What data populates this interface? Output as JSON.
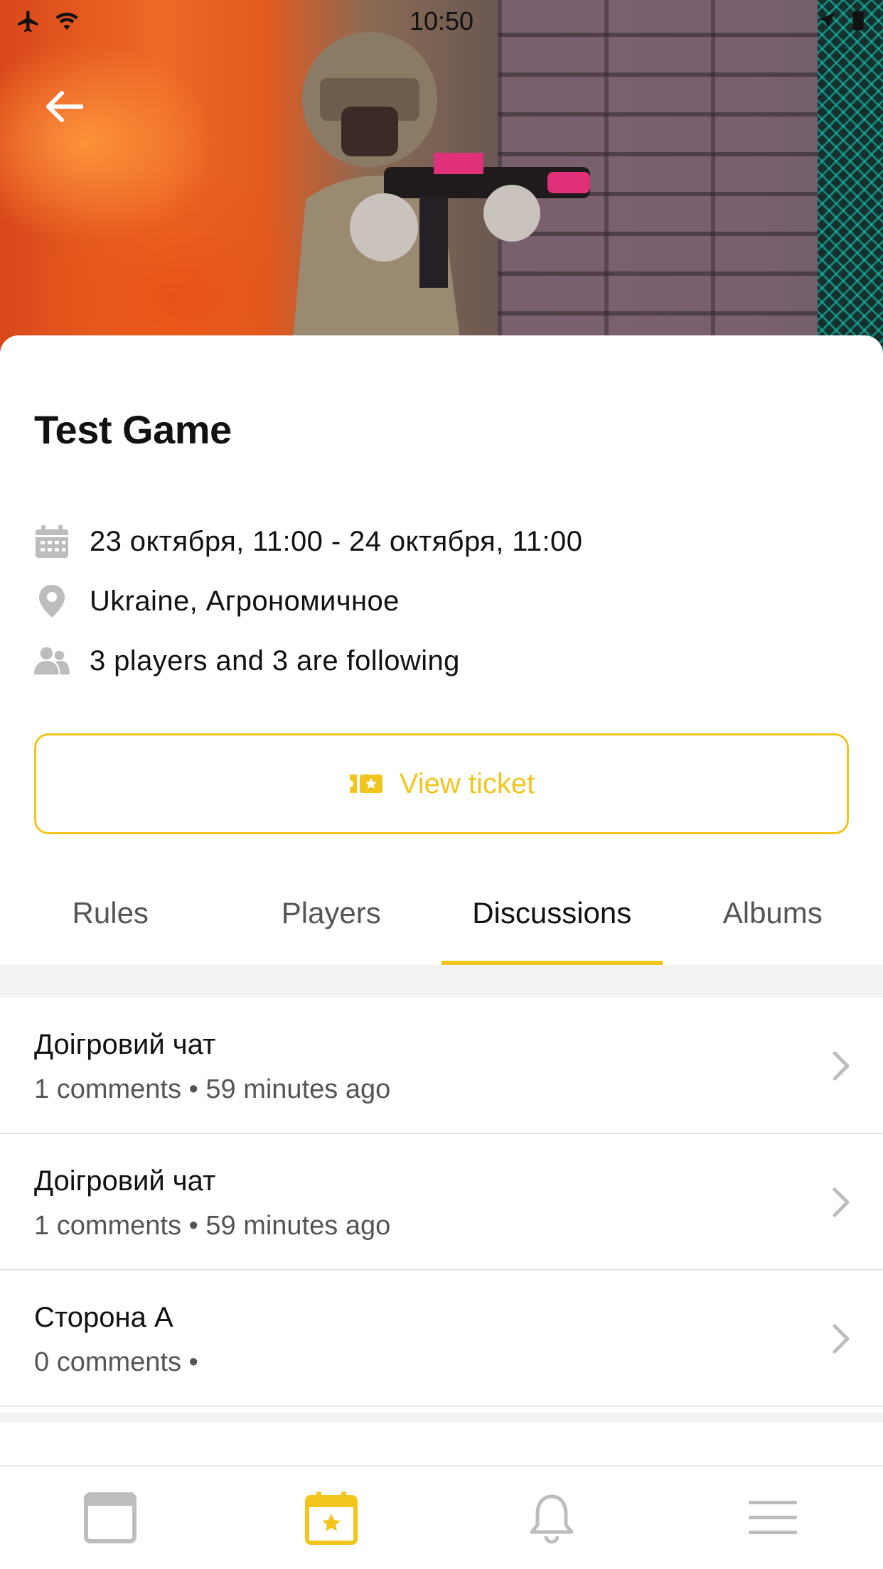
{
  "status_bar": {
    "time": "10:50"
  },
  "event": {
    "title": "Test Game",
    "date_range": "23 октября, 11:00 - 24 октября, 11:00",
    "location": "Ukraine, Агрономичное",
    "participants": "3  players and 3 are following"
  },
  "ticket_button": {
    "label": "View ticket"
  },
  "tabs": [
    {
      "label": "Rules"
    },
    {
      "label": "Players"
    },
    {
      "label": "Discussions"
    },
    {
      "label": "Albums"
    }
  ],
  "discussions": [
    {
      "title": "Доігровий чат",
      "meta": "1 comments • 59 minutes ago"
    },
    {
      "title": "Доігровий чат",
      "meta": "1 comments • 59 minutes ago"
    },
    {
      "title": "Сторона А",
      "meta": "0 comments •"
    }
  ],
  "colors": {
    "accent": "#f2c51d",
    "icon_gray": "#bdbdbd"
  },
  "bottom_nav": [
    "feed-icon",
    "calendar-star-icon",
    "bell-icon",
    "menu-icon"
  ]
}
